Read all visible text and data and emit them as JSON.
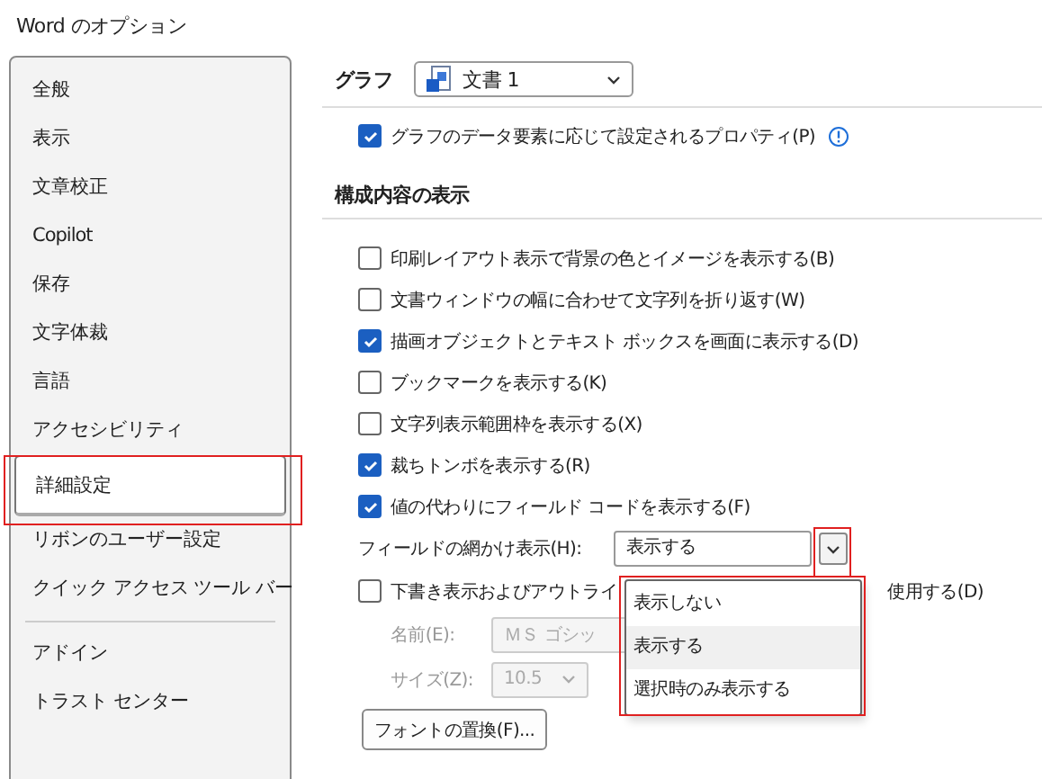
{
  "window": {
    "title": "Word のオプション"
  },
  "sidebar": {
    "groups": [
      {
        "items": [
          {
            "label": "全般",
            "selected": false
          },
          {
            "label": "表示",
            "selected": false
          },
          {
            "label": "文章校正",
            "selected": false
          },
          {
            "label": "Copilot",
            "selected": false
          },
          {
            "label": "保存",
            "selected": false
          },
          {
            "label": "文字体裁",
            "selected": false
          },
          {
            "label": "言語",
            "selected": false
          },
          {
            "label": "アクセシビリティ",
            "selected": false
          },
          {
            "label": "詳細設定",
            "selected": true
          },
          {
            "label": "リボンのユーザー設定",
            "selected": false
          },
          {
            "label": "クイック アクセス ツール バー",
            "selected": false
          }
        ]
      },
      {
        "items": [
          {
            "label": "アドイン",
            "selected": false
          },
          {
            "label": "トラスト センター",
            "selected": false
          }
        ]
      }
    ]
  },
  "chart_section": {
    "heading": "グラフ",
    "document": "文書 1",
    "option": {
      "label": "グラフのデータ要素に応じて設定されるプロパティ(P)",
      "checked": true
    }
  },
  "display_section": {
    "heading": "構成内容の表示",
    "options": [
      {
        "label": "印刷レイアウト表示で背景の色とイメージを表示する(B)",
        "checked": false
      },
      {
        "label": "文書ウィンドウの幅に合わせて文字列を折り返す(W)",
        "checked": false
      },
      {
        "label": "描画オブジェクトとテキスト ボックスを画面に表示する(D)",
        "checked": true
      },
      {
        "label": "ブックマークを表示する(K)",
        "checked": false
      },
      {
        "label": "文字列表示範囲枠を表示する(X)",
        "checked": false
      },
      {
        "label": "裁ちトンボを表示する(R)",
        "checked": true
      },
      {
        "label": "値の代わりにフィールド コードを表示する(F)",
        "checked": true
      }
    ],
    "field_shading": {
      "label": "フィールドの網かけ表示(H):",
      "value": "表示する",
      "options": [
        {
          "label": "表示しない",
          "selected": false
        },
        {
          "label": "表示する",
          "selected": true
        },
        {
          "label": "選択時のみ表示する",
          "selected": false
        }
      ]
    },
    "draft_font": {
      "label_start": "下書き表示およびアウトライ",
      "label_end": "使用する(D)",
      "checked": false,
      "fields": [
        {
          "label": "名前(E):",
          "value": "ＭＳ ゴシッ",
          "kind": "text"
        },
        {
          "label": "サイズ(Z):",
          "value": "10.5",
          "kind": "combo"
        }
      ]
    },
    "font_button": "フォントの置換(F)..."
  }
}
